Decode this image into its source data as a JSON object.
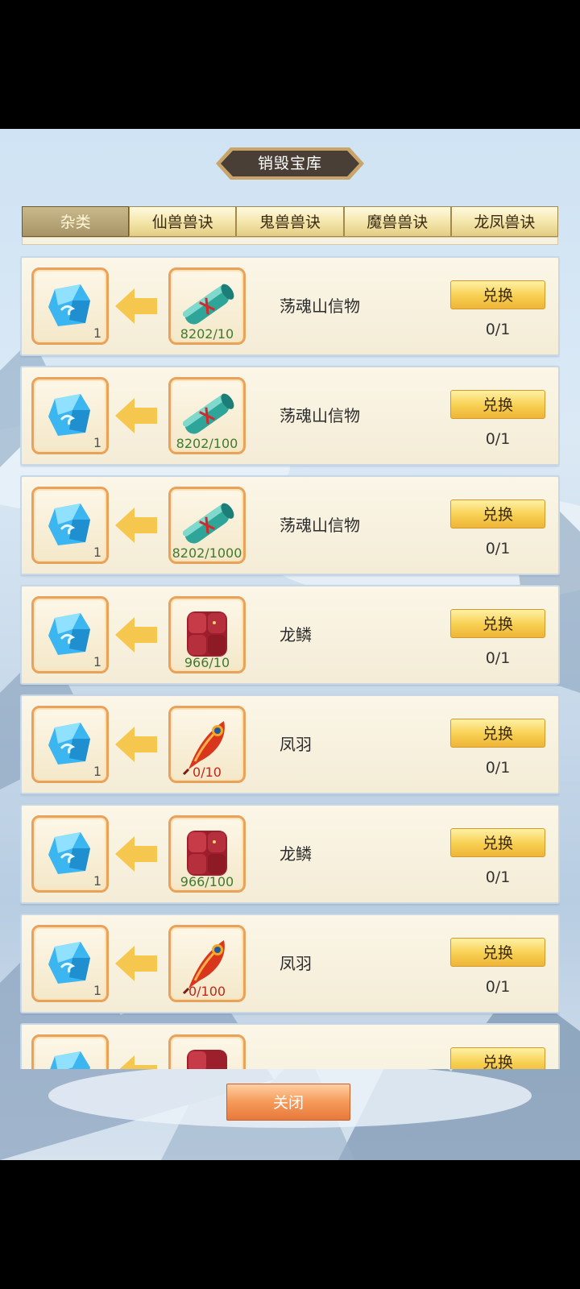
{
  "window": {
    "title": "销毁宝库"
  },
  "tabs": [
    {
      "label": "杂类",
      "active": true
    },
    {
      "label": "仙兽兽诀",
      "active": false
    },
    {
      "label": "鬼兽兽诀",
      "active": false
    },
    {
      "label": "魔兽兽诀",
      "active": false
    },
    {
      "label": "龙凤兽诀",
      "active": false
    }
  ],
  "rows": [
    {
      "reward_icon": "blue-crystal-icon",
      "reward_count": "1",
      "item_icon": "scroll-icon",
      "progress": "8202/10",
      "progress_state": "ok",
      "name": "荡魂山信物",
      "button": "兑换",
      "limit": "0/1"
    },
    {
      "reward_icon": "blue-crystal-icon",
      "reward_count": "1",
      "item_icon": "scroll-icon",
      "progress": "8202/100",
      "progress_state": "ok",
      "name": "荡魂山信物",
      "button": "兑换",
      "limit": "0/1"
    },
    {
      "reward_icon": "blue-crystal-icon",
      "reward_count": "1",
      "item_icon": "scroll-icon",
      "progress": "8202/1000",
      "progress_state": "ok",
      "name": "荡魂山信物",
      "button": "兑换",
      "limit": "0/1"
    },
    {
      "reward_icon": "blue-crystal-icon",
      "reward_count": "1",
      "item_icon": "dragon-scale-icon",
      "progress": "966/10",
      "progress_state": "ok",
      "name": "龙鳞",
      "button": "兑换",
      "limit": "0/1"
    },
    {
      "reward_icon": "blue-crystal-icon",
      "reward_count": "1",
      "item_icon": "phoenix-feather-icon",
      "progress": "0/10",
      "progress_state": "bad",
      "name": "凤羽",
      "button": "兑换",
      "limit": "0/1"
    },
    {
      "reward_icon": "blue-crystal-icon",
      "reward_count": "1",
      "item_icon": "dragon-scale-icon",
      "progress": "966/100",
      "progress_state": "ok",
      "name": "龙鳞",
      "button": "兑换",
      "limit": "0/1"
    },
    {
      "reward_icon": "blue-crystal-icon",
      "reward_count": "1",
      "item_icon": "phoenix-feather-icon",
      "progress": "0/100",
      "progress_state": "bad",
      "name": "凤羽",
      "button": "兑换",
      "limit": "0/1"
    },
    {
      "reward_icon": "blue-crystal-icon",
      "reward_count": "",
      "item_icon": "dragon-scale-icon",
      "progress": "",
      "progress_state": "ok",
      "name": "",
      "button": "兑换",
      "limit": ""
    }
  ],
  "footer": {
    "close_label": "关闭"
  },
  "colors": {
    "accent": "#f7cf50",
    "tab_active": "#a79567",
    "progress_ok": "#3f7a2f",
    "progress_bad": "#c0271b"
  }
}
